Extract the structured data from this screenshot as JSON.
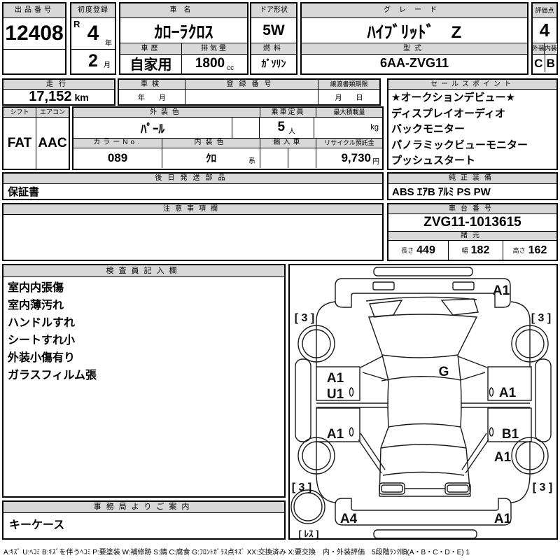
{
  "top": {
    "auction_no": {
      "label": "出品番号",
      "value": "12408"
    },
    "first_reg": {
      "label": "初度登録",
      "era": "R",
      "year": "4",
      "year_unit": "年",
      "month": "2",
      "month_unit": "月"
    },
    "car_name": {
      "label": "車名",
      "value": "ｶﾛｰﾗｸﾛｽ"
    },
    "history": {
      "label": "車歴",
      "value": "自家用"
    },
    "displacement": {
      "label": "排気量",
      "value": "1800",
      "unit": "cc"
    },
    "door_shape": {
      "label": "ドア形状",
      "value": "5W"
    },
    "fuel": {
      "label": "燃料",
      "value": "ｶﾞｿﾘﾝ"
    },
    "grade": {
      "label": "グレード",
      "value": "ﾊｲﾌﾞﾘｯﾄﾞ　Z"
    },
    "model_code": {
      "label": "型式",
      "value": "6AA-ZVG11"
    },
    "score": {
      "label": "評価点",
      "value": "4"
    },
    "exterior": {
      "label": "外装",
      "value": "C"
    },
    "interior": {
      "label": "内装",
      "value": "B"
    }
  },
  "mid": {
    "mileage": {
      "label": "走行",
      "value": "17,152",
      "unit": "km"
    },
    "shaken": {
      "label": "車検",
      "hint": "年　　月"
    },
    "reg_no": {
      "label": "登録番号",
      "value": ""
    },
    "transfer": {
      "label": "譲渡書類期限",
      "hint": "月　　日"
    },
    "sales": {
      "label": "セールスポイント",
      "points": [
        "★オークションデビュー★",
        "ディスプレイオーディオ",
        "バックモニター",
        "パノラミックビューモニター",
        "プッシュスタート"
      ]
    },
    "shift": {
      "label": "シフト",
      "value": "FAT"
    },
    "aircon": {
      "label": "エアコン",
      "value": "AAC"
    },
    "ext_color": {
      "label": "外装色",
      "value": "ﾊﾟｰﾙ"
    },
    "color_no": {
      "label": "カラーNo.",
      "value": "089"
    },
    "int_color": {
      "label": "内装色",
      "value": "ｸﾛ",
      "suffix": "系"
    },
    "capacity": {
      "label": "乗車定員",
      "value": "5",
      "unit": "人"
    },
    "max_load": {
      "label": "最大積載量",
      "unit": "kg"
    },
    "import_car": {
      "label": "輸入車",
      "value": ""
    },
    "recycle": {
      "label": "リサイクル預託金",
      "value": "9,730",
      "unit": "円"
    }
  },
  "parts": {
    "label": "後日発送部品",
    "value": "保証書"
  },
  "oem": {
    "label": "純正装備",
    "value": "ABS ｴｱB ｱﾙﾐ PS PW"
  },
  "notes": {
    "label": "注意事項欄",
    "value": ""
  },
  "vin": {
    "label": "車台番号",
    "value": "ZVG11-1013615"
  },
  "specs": {
    "label": "諸元",
    "length_label": "長さ",
    "length": "449",
    "width_label": "幅",
    "width": "182",
    "height_label": "高さ",
    "height": "162"
  },
  "inspector": {
    "label": "検査員記入欄",
    "notes": [
      "室内内張傷",
      "室内薄汚れ",
      "ハンドルすれ",
      "シートすれ小",
      "外装小傷有り",
      "ガラスフィルム張"
    ]
  },
  "office": {
    "label": "事務局よりご案内",
    "value": "キーケース"
  },
  "diagram": {
    "front_bumper": "A1",
    "tire_fl": "[ 3 ]",
    "tire_fr": "[ 3 ]",
    "tire_rl": "[ 3 ]",
    "tire_rr": "[ 3 ]",
    "glass": "G",
    "door_lf_1": "A1",
    "door_lf_2": "U1",
    "door_lr": "A1",
    "door_rf": "A1",
    "door_rr": "B1",
    "fender_rr": "A1",
    "rear_bumper_l": "A4",
    "rear_bumper_r": "A1",
    "spare": "[ ﾚｽ ]"
  },
  "footer": {
    "legend": "A:ｷｽﾞ U:ﾍｺﾐ B:ｷｽﾞを伴うﾍｺﾐ P:要塗装 W:補修跡 S:錆 C:腐食 G:ﾌﾛﾝﾄｶﾞﾗｽ点ｷｽﾞ XX:交換済み X:要交換　内・外装評価　5段階ﾗﾝｸ順(A・B・C・D・E) 1"
  }
}
